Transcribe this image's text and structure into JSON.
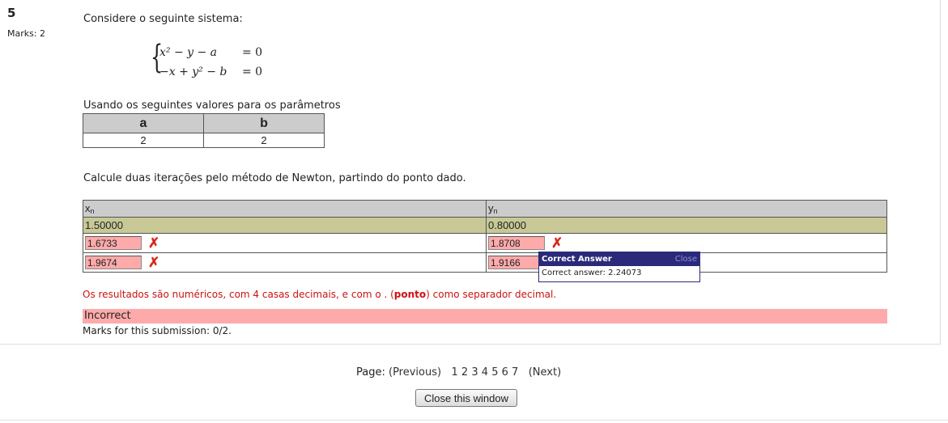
{
  "question": {
    "number": "5",
    "marks_label": "Marks: 2",
    "intro": "Considere o seguinte sistema:",
    "equations": [
      {
        "lhs": "x² − y − a",
        "rhs": "= 0"
      },
      {
        "lhs": "−x + y² − b",
        "rhs": "= 0"
      }
    ],
    "params_intro": "Usando os seguintes valores para os parâmetros",
    "params_table": {
      "headers": [
        "a",
        "b"
      ],
      "values": [
        "2",
        "2"
      ]
    },
    "instruction": "Calcule duas iterações pelo método de Newton, partindo do ponto dado.",
    "iter_table": {
      "header_x": "x",
      "header_x_sub": "n",
      "header_y": "y",
      "header_y_sub": "n",
      "start_x": "1.50000",
      "start_y": "0.80000",
      "rows": [
        {
          "x": "1.6733",
          "y": "1.8708",
          "x_mark": "✗",
          "y_mark": "✗"
        },
        {
          "x": "1.9674",
          "y": "1.9166",
          "x_mark": "✗"
        }
      ]
    },
    "popup": {
      "title": "Correct Answer",
      "close_label": "Close",
      "body": "Correct answer: 2.24073"
    },
    "note_before": "Os resultados são numéricos, com 4 casas decimais, e com o . (",
    "note_bold": "ponto",
    "note_after": ") como separador decimal.",
    "result": "Incorrect",
    "submission_marks": "Marks for this submission: 0/2."
  },
  "pager": {
    "label": "Page:",
    "previous": "(Previous)",
    "pages": [
      "1",
      "2",
      "3",
      "4",
      "5",
      "6",
      "7"
    ],
    "next": "(Next)"
  },
  "close_button": "Close this window"
}
